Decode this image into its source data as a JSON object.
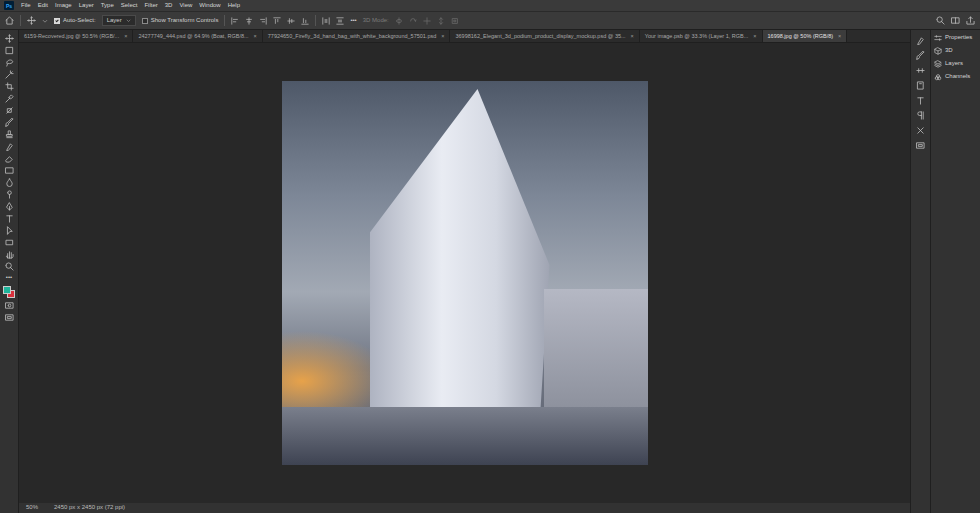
{
  "app": {
    "logo": "Ps"
  },
  "menu": [
    "File",
    "Edit",
    "Image",
    "Layer",
    "Type",
    "Select",
    "Filter",
    "3D",
    "View",
    "Window",
    "Help"
  ],
  "options": {
    "auto_select": {
      "label": "Auto-Select:",
      "checked": true
    },
    "target": "Layer",
    "transform": {
      "label": "Show Transform Controls",
      "checked": false
    },
    "more": "•••",
    "mode_3d": {
      "label": "3D Mode:",
      "disabled": true
    }
  },
  "tabs": [
    {
      "label": "6159-Recovered.jpg @ 50.5% (RGB/...",
      "close": "×",
      "selected": false
    },
    {
      "label": "24277749_444.psd @ 64.9% (Boat, RGB/8...",
      "close": "×",
      "selected": false
    },
    {
      "label": "77924650_Firefly_3d_hand_bag_with_white_background_57501.psd",
      "close": "×",
      "selected": false
    },
    {
      "label": "36998162_Elegant_3d_podium_product_display_mockup.psd @ 35...",
      "close": "×",
      "selected": false
    },
    {
      "label": "Your image.psb @ 33.3% (Layer 1, RGB...",
      "close": "×",
      "selected": false
    },
    {
      "label": "16998.jpg @ 50% (RGB/8)",
      "close": "×",
      "selected": true
    }
  ],
  "tools_more": "•••",
  "swatches": {
    "foreground": "#1fb39a",
    "background": "#d8303c"
  },
  "panels": [
    {
      "label": "Properties"
    },
    {
      "label": "3D"
    },
    {
      "label": "Layers"
    },
    {
      "label": "Channels"
    }
  ],
  "status_bar": {
    "zoom": "50%",
    "size": "2450 px x 2450 px (72 ppi)"
  }
}
